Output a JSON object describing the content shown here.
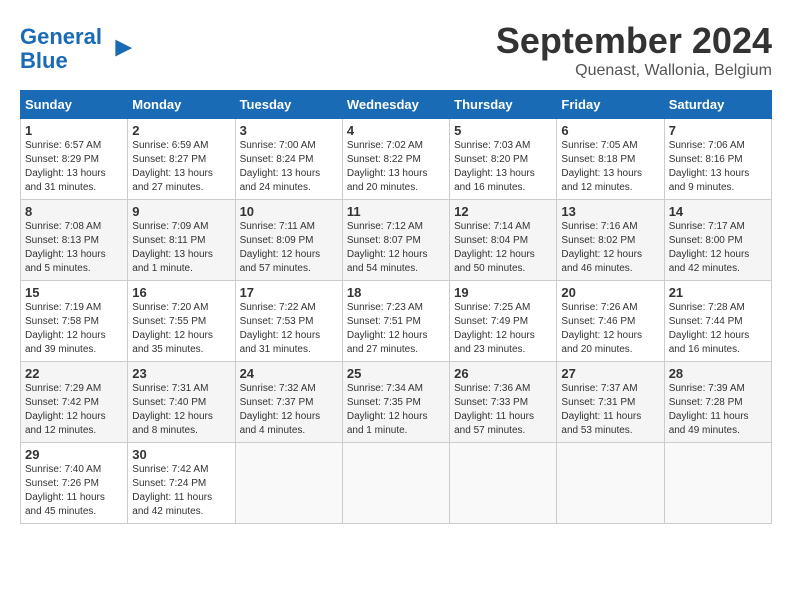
{
  "logo": {
    "line1": "General",
    "line2": "Blue"
  },
  "title": "September 2024",
  "subtitle": "Quenast, Wallonia, Belgium",
  "days_header": [
    "Sunday",
    "Monday",
    "Tuesday",
    "Wednesday",
    "Thursday",
    "Friday",
    "Saturday"
  ],
  "weeks": [
    [
      {
        "day": "1",
        "info": "Sunrise: 6:57 AM\nSunset: 8:29 PM\nDaylight: 13 hours\nand 31 minutes."
      },
      {
        "day": "2",
        "info": "Sunrise: 6:59 AM\nSunset: 8:27 PM\nDaylight: 13 hours\nand 27 minutes."
      },
      {
        "day": "3",
        "info": "Sunrise: 7:00 AM\nSunset: 8:24 PM\nDaylight: 13 hours\nand 24 minutes."
      },
      {
        "day": "4",
        "info": "Sunrise: 7:02 AM\nSunset: 8:22 PM\nDaylight: 13 hours\nand 20 minutes."
      },
      {
        "day": "5",
        "info": "Sunrise: 7:03 AM\nSunset: 8:20 PM\nDaylight: 13 hours\nand 16 minutes."
      },
      {
        "day": "6",
        "info": "Sunrise: 7:05 AM\nSunset: 8:18 PM\nDaylight: 13 hours\nand 12 minutes."
      },
      {
        "day": "7",
        "info": "Sunrise: 7:06 AM\nSunset: 8:16 PM\nDaylight: 13 hours\nand 9 minutes."
      }
    ],
    [
      {
        "day": "8",
        "info": "Sunrise: 7:08 AM\nSunset: 8:13 PM\nDaylight: 13 hours\nand 5 minutes."
      },
      {
        "day": "9",
        "info": "Sunrise: 7:09 AM\nSunset: 8:11 PM\nDaylight: 13 hours\nand 1 minute."
      },
      {
        "day": "10",
        "info": "Sunrise: 7:11 AM\nSunset: 8:09 PM\nDaylight: 12 hours\nand 57 minutes."
      },
      {
        "day": "11",
        "info": "Sunrise: 7:12 AM\nSunset: 8:07 PM\nDaylight: 12 hours\nand 54 minutes."
      },
      {
        "day": "12",
        "info": "Sunrise: 7:14 AM\nSunset: 8:04 PM\nDaylight: 12 hours\nand 50 minutes."
      },
      {
        "day": "13",
        "info": "Sunrise: 7:16 AM\nSunset: 8:02 PM\nDaylight: 12 hours\nand 46 minutes."
      },
      {
        "day": "14",
        "info": "Sunrise: 7:17 AM\nSunset: 8:00 PM\nDaylight: 12 hours\nand 42 minutes."
      }
    ],
    [
      {
        "day": "15",
        "info": "Sunrise: 7:19 AM\nSunset: 7:58 PM\nDaylight: 12 hours\nand 39 minutes."
      },
      {
        "day": "16",
        "info": "Sunrise: 7:20 AM\nSunset: 7:55 PM\nDaylight: 12 hours\nand 35 minutes."
      },
      {
        "day": "17",
        "info": "Sunrise: 7:22 AM\nSunset: 7:53 PM\nDaylight: 12 hours\nand 31 minutes."
      },
      {
        "day": "18",
        "info": "Sunrise: 7:23 AM\nSunset: 7:51 PM\nDaylight: 12 hours\nand 27 minutes."
      },
      {
        "day": "19",
        "info": "Sunrise: 7:25 AM\nSunset: 7:49 PM\nDaylight: 12 hours\nand 23 minutes."
      },
      {
        "day": "20",
        "info": "Sunrise: 7:26 AM\nSunset: 7:46 PM\nDaylight: 12 hours\nand 20 minutes."
      },
      {
        "day": "21",
        "info": "Sunrise: 7:28 AM\nSunset: 7:44 PM\nDaylight: 12 hours\nand 16 minutes."
      }
    ],
    [
      {
        "day": "22",
        "info": "Sunrise: 7:29 AM\nSunset: 7:42 PM\nDaylight: 12 hours\nand 12 minutes."
      },
      {
        "day": "23",
        "info": "Sunrise: 7:31 AM\nSunset: 7:40 PM\nDaylight: 12 hours\nand 8 minutes."
      },
      {
        "day": "24",
        "info": "Sunrise: 7:32 AM\nSunset: 7:37 PM\nDaylight: 12 hours\nand 4 minutes."
      },
      {
        "day": "25",
        "info": "Sunrise: 7:34 AM\nSunset: 7:35 PM\nDaylight: 12 hours\nand 1 minute."
      },
      {
        "day": "26",
        "info": "Sunrise: 7:36 AM\nSunset: 7:33 PM\nDaylight: 11 hours\nand 57 minutes."
      },
      {
        "day": "27",
        "info": "Sunrise: 7:37 AM\nSunset: 7:31 PM\nDaylight: 11 hours\nand 53 minutes."
      },
      {
        "day": "28",
        "info": "Sunrise: 7:39 AM\nSunset: 7:28 PM\nDaylight: 11 hours\nand 49 minutes."
      }
    ],
    [
      {
        "day": "29",
        "info": "Sunrise: 7:40 AM\nSunset: 7:26 PM\nDaylight: 11 hours\nand 45 minutes."
      },
      {
        "day": "30",
        "info": "Sunrise: 7:42 AM\nSunset: 7:24 PM\nDaylight: 11 hours\nand 42 minutes."
      },
      {
        "day": "",
        "info": ""
      },
      {
        "day": "",
        "info": ""
      },
      {
        "day": "",
        "info": ""
      },
      {
        "day": "",
        "info": ""
      },
      {
        "day": "",
        "info": ""
      }
    ]
  ]
}
